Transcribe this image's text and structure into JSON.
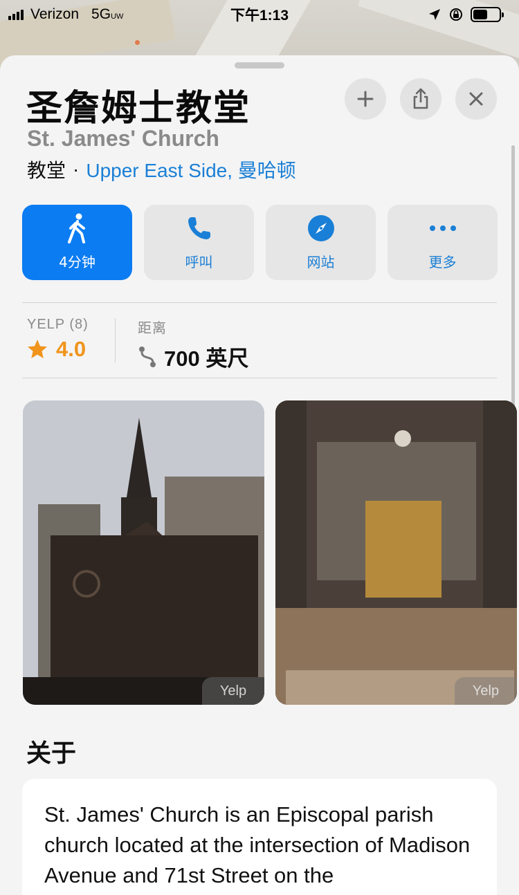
{
  "status_bar": {
    "carrier": "Verizon",
    "network": "5G",
    "network_sub": "UW",
    "time": "下午1:13"
  },
  "place": {
    "title": "圣詹姆士教堂",
    "subtitle": "St. James' Church",
    "category": "教堂",
    "separator": "·",
    "location": "Upper East Side, 曼哈顿"
  },
  "header_buttons": {
    "add": "add-icon",
    "share": "share-icon",
    "close": "close-icon"
  },
  "actions": [
    {
      "label": "4分钟",
      "icon": "walk-icon"
    },
    {
      "label": "呼叫",
      "icon": "phone-icon"
    },
    {
      "label": "网站",
      "icon": "compass-icon"
    },
    {
      "label": "更多",
      "icon": "more-icon"
    }
  ],
  "stats": {
    "yelp_label": "YELP (8)",
    "rating": "4.0",
    "distance_label": "距离",
    "distance": "700 英尺"
  },
  "photos": [
    {
      "credit": "Yelp"
    },
    {
      "credit": "Yelp"
    }
  ],
  "about": {
    "heading": "关于",
    "text": "St. James' Church is an Episcopal parish church located at the intersection of Madison Avenue and 71st Street on the"
  },
  "colors": {
    "accent": "#0b7cf2",
    "link": "#1a7fd6",
    "rating": "#f0941b"
  }
}
